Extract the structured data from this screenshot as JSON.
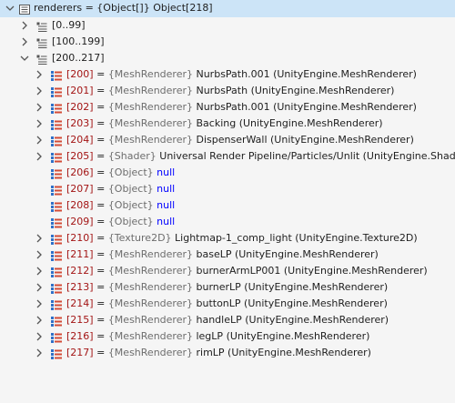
{
  "root": {
    "label": "renderers",
    "eq": " = ",
    "value": "{Object[]} Object[218]"
  },
  "groups": [
    {
      "label": "[0..99]",
      "expanded": false
    },
    {
      "label": "[100..199]",
      "expanded": false
    },
    {
      "label": "[200..217]",
      "expanded": true
    }
  ],
  "items": [
    {
      "index": "[200]",
      "type": "{MeshRenderer}",
      "name": "NurbsPath.001",
      "class": "(UnityEngine.MeshRenderer)",
      "expandable": true
    },
    {
      "index": "[201]",
      "type": "{MeshRenderer}",
      "name": "NurbsPath",
      "class": "(UnityEngine.MeshRenderer)",
      "expandable": true
    },
    {
      "index": "[202]",
      "type": "{MeshRenderer}",
      "name": "NurbsPath.001",
      "class": "(UnityEngine.MeshRenderer)",
      "expandable": true
    },
    {
      "index": "[203]",
      "type": "{MeshRenderer}",
      "name": "Backing",
      "class": "(UnityEngine.MeshRenderer)",
      "expandable": true
    },
    {
      "index": "[204]",
      "type": "{MeshRenderer}",
      "name": "DispenserWall",
      "class": "(UnityEngine.MeshRenderer)",
      "expandable": true
    },
    {
      "index": "[205]",
      "type": "{Shader}",
      "name": "Universal Render Pipeline/Particles/Unlit",
      "class": "(UnityEngine.Shader)",
      "expandable": true
    },
    {
      "index": "[206]",
      "type": "{Object}",
      "name": "null",
      "class": "",
      "expandable": false,
      "is_null": true
    },
    {
      "index": "[207]",
      "type": "{Object}",
      "name": "null",
      "class": "",
      "expandable": false,
      "is_null": true
    },
    {
      "index": "[208]",
      "type": "{Object}",
      "name": "null",
      "class": "",
      "expandable": false,
      "is_null": true
    },
    {
      "index": "[209]",
      "type": "{Object}",
      "name": "null",
      "class": "",
      "expandable": false,
      "is_null": true
    },
    {
      "index": "[210]",
      "type": "{Texture2D}",
      "name": "Lightmap-1_comp_light",
      "class": "(UnityEngine.Texture2D)",
      "expandable": true
    },
    {
      "index": "[211]",
      "type": "{MeshRenderer}",
      "name": "baseLP",
      "class": "(UnityEngine.MeshRenderer)",
      "expandable": true
    },
    {
      "index": "[212]",
      "type": "{MeshRenderer}",
      "name": "burnerArmLP001",
      "class": "(UnityEngine.MeshRenderer)",
      "expandable": true
    },
    {
      "index": "[213]",
      "type": "{MeshRenderer}",
      "name": "burnerLP",
      "class": "(UnityEngine.MeshRenderer)",
      "expandable": true
    },
    {
      "index": "[214]",
      "type": "{MeshRenderer}",
      "name": "buttonLP",
      "class": "(UnityEngine.MeshRenderer)",
      "expandable": true
    },
    {
      "index": "[215]",
      "type": "{MeshRenderer}",
      "name": "handleLP",
      "class": "(UnityEngine.MeshRenderer)",
      "expandable": true
    },
    {
      "index": "[216]",
      "type": "{MeshRenderer}",
      "name": "legLP",
      "class": "(UnityEngine.MeshRenderer)",
      "expandable": true
    },
    {
      "index": "[217]",
      "type": "{MeshRenderer}",
      "name": "rimLP",
      "class": "(UnityEngine.MeshRenderer)",
      "expandable": true
    }
  ],
  "icons": {
    "expanded": "chevron-down-icon",
    "collapsed": "chevron-right-icon",
    "array": "array-icon",
    "group": "array-group-icon",
    "field": "field-icon"
  },
  "colors": {
    "selection": "#cce4f7",
    "index": "#a31515",
    "type": "#6d6d6d",
    "null": "#0000ff",
    "field_icon_blue": "#2f6fc6",
    "field_icon_red": "#d24b36"
  }
}
